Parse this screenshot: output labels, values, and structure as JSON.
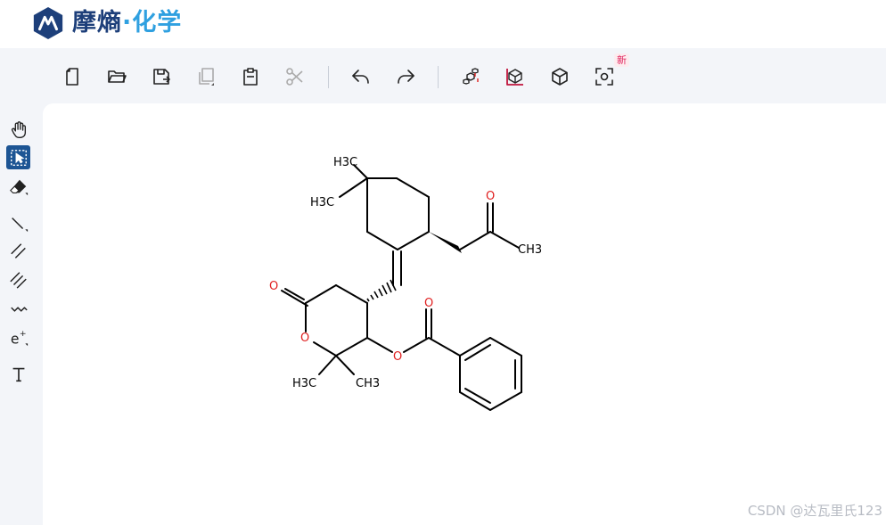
{
  "app": {
    "brand_part1": "摩熵",
    "brand_dot": "·",
    "brand_part2": "化学",
    "brand_color": "#1d3f7a",
    "accent_color": "#2fa0e0"
  },
  "toolbar": {
    "new_badge": "新",
    "buttons": [
      "new-file-icon",
      "open-folder-icon",
      "save-icon",
      "copy-icon",
      "paste-icon",
      "cut-icon",
      "undo-icon",
      "redo-icon",
      "structure-3d-icon",
      "chart-3d-icon",
      "cube-icon",
      "scan-icon"
    ]
  },
  "sidebar": {
    "tools": [
      "hand-icon",
      "select-icon",
      "eraser-icon",
      "single-bond-icon",
      "double-bond-icon",
      "triple-bond-icon",
      "wavy-bond-icon",
      "charge-icon",
      "text-icon"
    ],
    "active_tool": "select-icon"
  },
  "molecule": {
    "labels": {
      "h3c_top": "H3C",
      "h3c_left": "H3C",
      "ketone_o": "O",
      "ch3_right": "CH3",
      "lactone_carbonyl_o": "O",
      "ring_o": "O",
      "ester_o": "O",
      "ester_carbonyl_o": "O",
      "h3c_bottom": "H3C",
      "ch3_bottom": "CH3"
    },
    "atom_color_oxygen": "#e02020",
    "bond_color": "#000000"
  },
  "watermark": "CSDN @达瓦里氏123"
}
